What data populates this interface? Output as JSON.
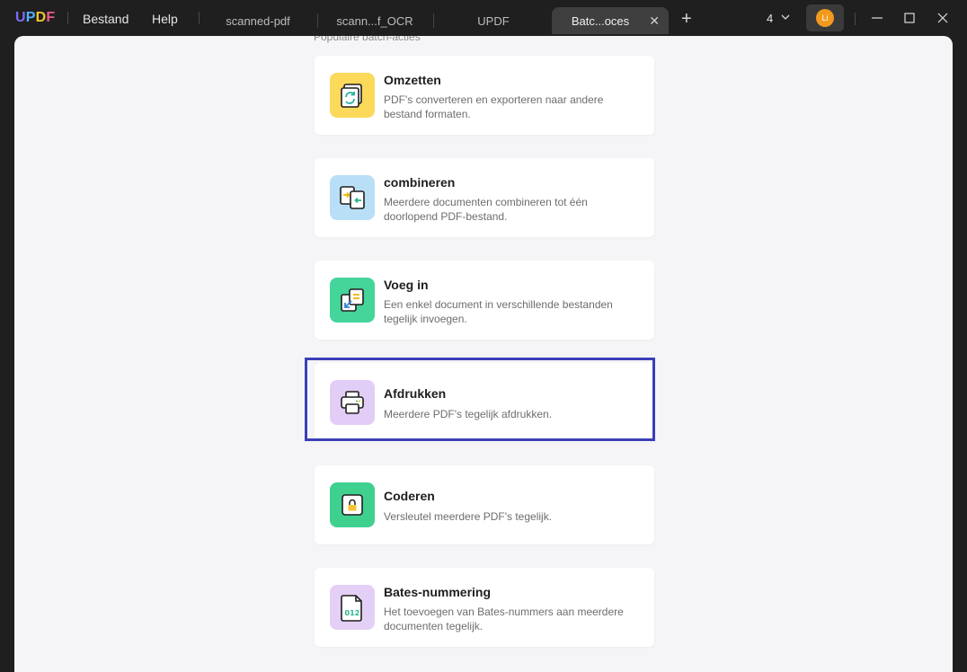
{
  "app": {
    "logo": {
      "u": "U",
      "p": "P",
      "d": "D",
      "f": "F"
    },
    "menu": {
      "file": "Bestand",
      "help": "Help"
    }
  },
  "tabs": [
    {
      "label": "scanned-pdf"
    },
    {
      "label": "scann...f_OCR"
    },
    {
      "label": "UPDF"
    },
    {
      "label": "Batc...oces",
      "close": "✕"
    }
  ],
  "toolbar": {
    "new_tab": "+",
    "count": "4",
    "avatar_initials": "Li"
  },
  "section": {
    "title": "Populaire batch-acties"
  },
  "actions": [
    {
      "title": "Omzetten",
      "desc": "PDF's converteren en exporteren naar andere bestand formaten.",
      "icon": "convert-icon",
      "color": "#fbd95a"
    },
    {
      "title": "combineren",
      "desc": "Meerdere documenten combineren tot één doorlopend PDF-bestand.",
      "icon": "combine-icon",
      "color": "#b9dff7"
    },
    {
      "title": "Voeg in",
      "desc": "Een enkel document in verschillende bestanden tegelijk invoegen.",
      "icon": "insert-icon",
      "color": "#45d49a"
    },
    {
      "title": "Afdrukken",
      "desc": "Meerdere PDF's tegelijk afdrukken.",
      "icon": "print-icon",
      "color": "#e2cdf7"
    },
    {
      "title": "Coderen",
      "desc": "Versleutel meerdere PDF's tegelijk.",
      "icon": "lock-icon",
      "color": "#3fd08f"
    },
    {
      "title": "Bates-nummering",
      "desc": "Het toevoegen van Bates-nummers aan meerdere documenten tegelijk.",
      "icon": "bates-number-icon",
      "color": "#e4cff6",
      "icon_text": "012"
    }
  ],
  "colors": {
    "highlight": "#3b3fb8",
    "content_bg": "#f5f5f7",
    "titlebar_bg": "#1f1f1f"
  }
}
